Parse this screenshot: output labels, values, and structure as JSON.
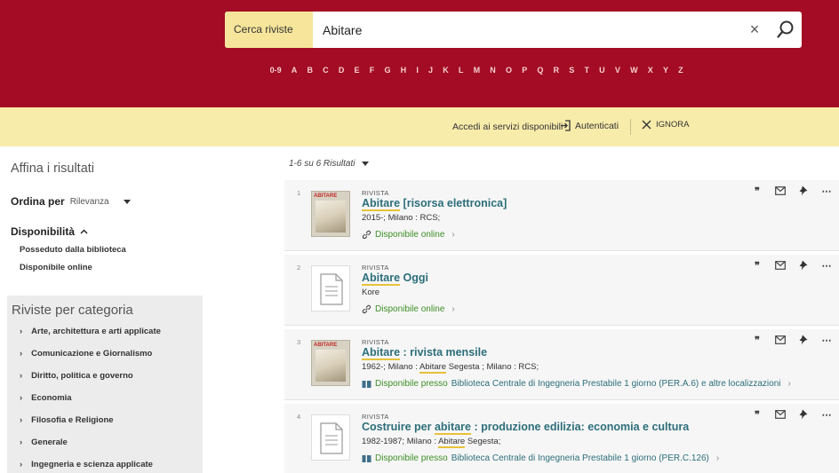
{
  "search": {
    "scope_label": "Cerca riviste",
    "query": "Abitare"
  },
  "alpha_nav": [
    "0-9",
    "A",
    "B",
    "C",
    "D",
    "E",
    "F",
    "G",
    "H",
    "I",
    "J",
    "K",
    "L",
    "M",
    "N",
    "O",
    "P",
    "Q",
    "R",
    "S",
    "T",
    "U",
    "V",
    "W",
    "X",
    "Y",
    "Z"
  ],
  "banner": {
    "services_text": "Accedi ai servizi disponibili",
    "login_label": "Autenticati",
    "dismiss_label": "IGNORA"
  },
  "facets": {
    "title": "Affina i risultati",
    "sort_label": "Ordina per",
    "sort_value": "Rilevanza",
    "availability_label": "Disponibilità",
    "availability_items": [
      "Posseduto dalla biblioteca",
      "Disponibile online"
    ],
    "categories_title": "Riviste per categoria",
    "categories": [
      "Arte, architettura e arti applicate",
      "Comunicazione e Giornalismo",
      "Diritto, politica e governo",
      "Economia",
      "Filosofia e Religione",
      "Generale",
      "Ingegneria e scienza applicate"
    ]
  },
  "results_count": "1-6 su 6 Risultati",
  "results": [
    {
      "num": "1",
      "type": "RIVISTA",
      "title_hl": "Abitare",
      "title_rest": " [risorsa elettronica]",
      "meta_pre": "2015-; Milano : RCS;",
      "meta_hl": "",
      "meta_post": "",
      "avail_text": "Disponibile online",
      "avail_loc": "",
      "thumb": "cover"
    },
    {
      "num": "2",
      "type": "RIVISTA",
      "title_hl": "Abitare",
      "title_rest": " Oggi",
      "meta_pre": "Kore",
      "meta_hl": "",
      "meta_post": "",
      "avail_text": "Disponibile online",
      "avail_loc": "",
      "thumb": "doc"
    },
    {
      "num": "3",
      "type": "RIVISTA",
      "title_hl": "Abitare",
      "title_rest": " : rivista mensile",
      "meta_pre": "1962-; Milano : ",
      "meta_hl": "Abitare",
      "meta_post": " Segesta ; Milano : RCS;",
      "avail_text": "Disponibile presso",
      "avail_loc": "Biblioteca Centrale di Ingegneria  Prestabile 1 giorno (PER.A.6) e altre localizzazioni",
      "thumb": "cover"
    },
    {
      "num": "4",
      "type": "RIVISTA",
      "title_pre": "Costruire per ",
      "title_hl": "abitare",
      "title_rest": " : produzione edilizia: economia e cultura",
      "meta_pre": "1982-1987; Milano : ",
      "meta_hl": "Abitare",
      "meta_post": " Segesta;",
      "avail_text": "Disponibile presso",
      "avail_loc": "Biblioteca Centrale di Ingegneria  Prestabile 1 giorno (PER.C.126)",
      "thumb": "doc"
    }
  ],
  "cover_logo": "ABITARE",
  "colors": {
    "header_bg": "#a30c24",
    "banner_bg": "#f8ecab",
    "link": "#2c6e7a",
    "available": "#3e8f27",
    "highlight": "#e7c23a"
  }
}
